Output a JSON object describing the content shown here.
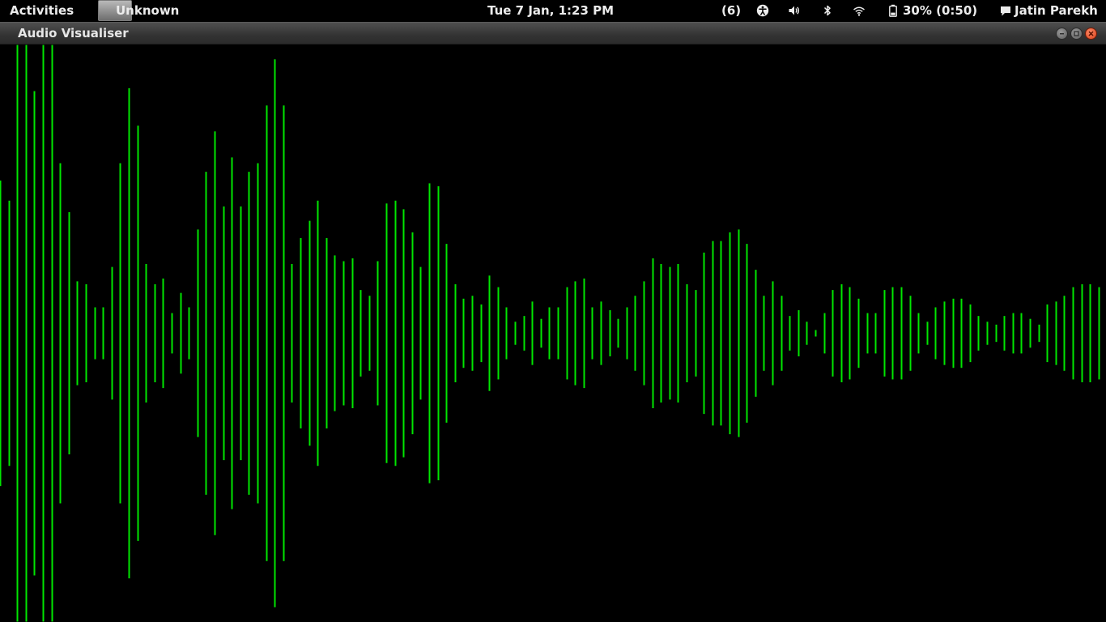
{
  "topbar": {
    "activities": "Activities",
    "app_name": "Unknown",
    "clock": "Tue  7 Jan,  1:23 PM",
    "notifications": "(6)",
    "battery": "30% (0:50)",
    "user": "Jatin Parekh",
    "icons": [
      "accessibility-icon",
      "volume-icon",
      "bluetooth-icon",
      "wifi-icon",
      "battery-icon",
      "chat-icon"
    ]
  },
  "window": {
    "title": "Audio Visualiser",
    "buttons": [
      "minimize",
      "maximize",
      "close"
    ]
  },
  "visualiser": {
    "background": "#000000",
    "bar_color": "#00e600",
    "amplitudes": [
      0.53,
      0.46,
      1,
      1,
      0.84,
      1,
      1,
      0.59,
      0.42,
      0.18,
      0.17,
      0.09,
      0.09,
      0.23,
      0.59,
      0.85,
      0.72,
      0.24,
      0.17,
      0.19,
      0.07,
      0.14,
      0.09,
      0.36,
      0.56,
      0.7,
      0.44,
      0.61,
      0.44,
      0.56,
      0.59,
      0.79,
      0.95,
      0.79,
      0.24,
      0.33,
      0.39,
      0.46,
      0.33,
      0.27,
      0.25,
      0.26,
      0.15,
      0.13,
      0.25,
      0.45,
      0.46,
      0.43,
      0.35,
      0.23,
      0.52,
      0.51,
      0.31,
      0.17,
      0.12,
      0.13,
      0.1,
      0.2,
      0.16,
      0.09,
      0.04,
      0.06,
      0.11,
      0.05,
      0.09,
      0.09,
      0.16,
      0.18,
      0.19,
      0.09,
      0.11,
      0.08,
      0.05,
      0.09,
      0.13,
      0.18,
      0.26,
      0.24,
      0.23,
      0.24,
      0.17,
      0.15,
      0.28,
      0.32,
      0.32,
      0.35,
      0.36,
      0.31,
      0.22,
      0.13,
      0.18,
      0.13,
      0.06,
      0.08,
      0.04,
      0.01,
      0.07,
      0.15,
      0.17,
      0.16,
      0.12,
      0.07,
      0.07,
      0.15,
      0.16,
      0.16,
      0.13,
      0.07,
      0.04,
      0.09,
      0.11,
      0.12,
      0.12,
      0.1,
      0.06,
      0.04,
      0.03,
      0.06,
      0.07,
      0.07,
      0.05,
      0.03,
      0.1,
      0.11,
      0.13,
      0.16,
      0.17,
      0.17,
      0.16,
      0.07,
      0.08,
      0.08,
      0.03,
      0.09,
      0.14
    ]
  }
}
